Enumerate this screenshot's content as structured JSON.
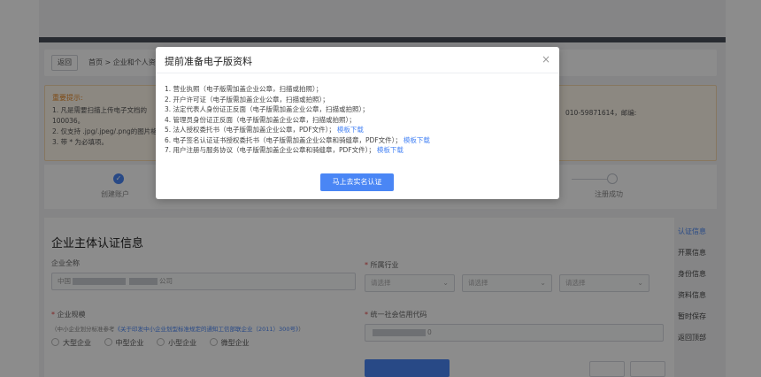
{
  "breadcrumb": {
    "back_label": "返回",
    "path": "首页 > 企业和个人资料"
  },
  "notice": {
    "title": "重要提示:",
    "line1": "1. 凡是需要扫描上传电子文档的",
    "line2": "100036。",
    "line3": "2. 仅支持 .jpg/.jpeg/.png的图片格",
    "line4": "3. 带 * 为必填项。",
    "contact": "010-59871614，邮编:"
  },
  "steps": [
    {
      "label": "创建账户",
      "status": "done"
    },
    {
      "label": "注册成功",
      "status": "todo"
    }
  ],
  "form": {
    "title": "企业主体认证信息",
    "name_label": "企业全称",
    "name_value_prefix": "中国",
    "name_value_suffix": "公司",
    "industry_label": "所属行业",
    "select_placeholder": "请选择",
    "size_label": "企业规模",
    "size_note_prefix": "（中小企业划分标准参考",
    "size_note_link": "《关于印发中小企业划型标准规定的通知工信部联企业（2011）300号》",
    "size_note_suffix": "）",
    "size_options": [
      "大型企业",
      "中型企业",
      "小型企业",
      "微型企业"
    ],
    "credit_label": "统一社会信用代码",
    "credit_value_suffix": "0"
  },
  "side_nav": [
    {
      "label": "认证信息",
      "active": true
    },
    {
      "label": "开票信息",
      "active": false
    },
    {
      "label": "身份信息",
      "active": false
    },
    {
      "label": "资料信息",
      "active": false
    },
    {
      "label": "暂时保存",
      "active": false
    },
    {
      "label": "返回顶部",
      "active": false
    }
  ],
  "modal": {
    "title": "提前准备电子版资料",
    "close_glyph": "×",
    "items": [
      {
        "text": "1. 营业执照（电子版需加盖企业公章，扫描或拍照）；",
        "link": ""
      },
      {
        "text": "2. 开户许可证（电子版需加盖企业公章，扫描或拍照）；",
        "link": ""
      },
      {
        "text": "3. 法定代表人身份证正反面（电子版需加盖企业公章，扫描或拍照）；",
        "link": ""
      },
      {
        "text": "4. 管理员身份证正反面（电子版需加盖企业公章，扫描或拍照）；",
        "link": ""
      },
      {
        "text": "5. 法人授权委托书（电子版需加盖企业公章，PDF文件）；",
        "link": "模板下载"
      },
      {
        "text": "6. 电子签名认证证书授权委托书（电子版需加盖企业公章和骑缝章，PDF文件）；",
        "link": "模板下载"
      },
      {
        "text": "7. 用户注册与服务协议（电子版需加盖企业公章和骑缝章，PDF文件）；",
        "link": "模板下载"
      }
    ],
    "confirm_label": "马上去实名认证"
  },
  "colors": {
    "accent": "#4a86f5",
    "notice_title": "#e58b2a",
    "required": "#e54545"
  }
}
